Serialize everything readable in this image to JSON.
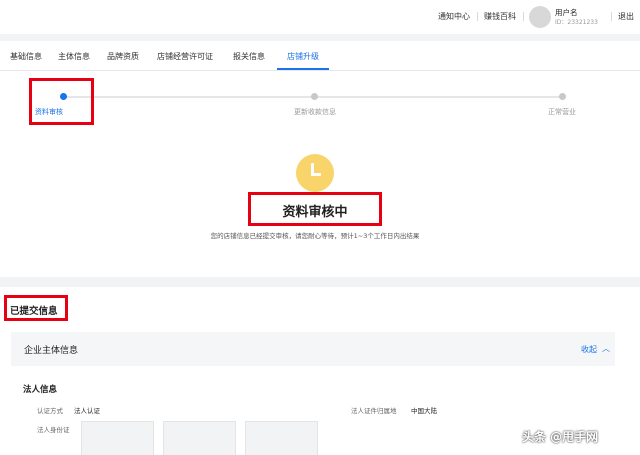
{
  "header": {
    "notifications": "通知中心",
    "earn_wiki": "赚钱百科",
    "user_name": "用户名",
    "user_id": "ID：23321233",
    "logout": "退出"
  },
  "tabs": [
    "基础信息",
    "主体信息",
    "品牌资质",
    "店铺经营许可证",
    "报关信息",
    "店铺升级"
  ],
  "active_tab": "店铺升级",
  "steps": [
    {
      "label": "资料审核",
      "active": true
    },
    {
      "label": "更新收款信息",
      "active": false
    },
    {
      "label": "正常营业",
      "active": false
    }
  ],
  "status": {
    "icon": "clock-icon",
    "icon_color": "#f8d46a",
    "title": "资料审核中",
    "description": "您的店铺信息已经提交审核，请您耐心等待，预计1~3个工作日内出结果"
  },
  "submitted": {
    "title": "已提交信息",
    "entity_section": {
      "title": "企业主体信息",
      "collapse_label": "收起"
    },
    "legal_person": {
      "title": "法人信息",
      "auth_method_label": "认证方式",
      "auth_method_value": "法人认证",
      "cert_region_label": "法人证件归属地",
      "cert_region_value": "中国大陆",
      "id_card_label": "法人身份证"
    }
  },
  "watermark": "头条 @甩手网",
  "colors": {
    "accent": "#1a73e8",
    "highlight": "#e60012",
    "pending": "#f8d46a"
  }
}
